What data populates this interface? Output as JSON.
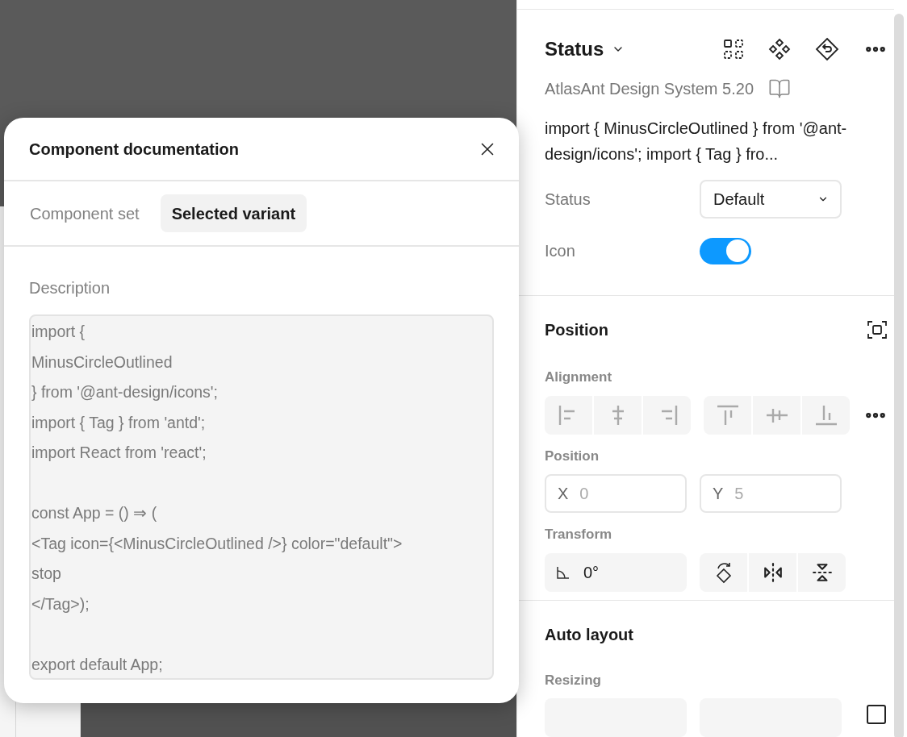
{
  "dialog": {
    "title": "Component documentation",
    "tabs": [
      {
        "label": "Component set",
        "selected": false
      },
      {
        "label": "Selected variant",
        "selected": true
      }
    ],
    "description_label": "Description",
    "description": "import {\nMinusCircleOutlined\n} from '@ant-design/icons';\nimport { Tag } from 'antd';\nimport React from 'react';\n\nconst App = () ⇒ (\n<Tag icon={<MinusCircleOutlined />} color=\"default\">\nstop\n</Tag>);\n\nexport default App;"
  },
  "panel": {
    "component": {
      "name": "Status",
      "library": "AtlasAnt Design System 5.20",
      "description": "import { MinusCircleOutlined } from '@ant-design/icons'; import { Tag } fro...",
      "properties": [
        {
          "kind": "select",
          "label": "Status",
          "value": "Default"
        },
        {
          "kind": "toggle",
          "label": "Icon",
          "on": true
        }
      ]
    },
    "position": {
      "title": "Position",
      "alignment_label": "Alignment",
      "position_label": "Position",
      "x": {
        "label": "X",
        "placeholder": "0"
      },
      "y": {
        "label": "Y",
        "placeholder": "5"
      },
      "transform_label": "Transform",
      "rotation": "0°"
    },
    "auto_layout": {
      "title": "Auto layout",
      "resizing_label": "Resizing"
    }
  }
}
